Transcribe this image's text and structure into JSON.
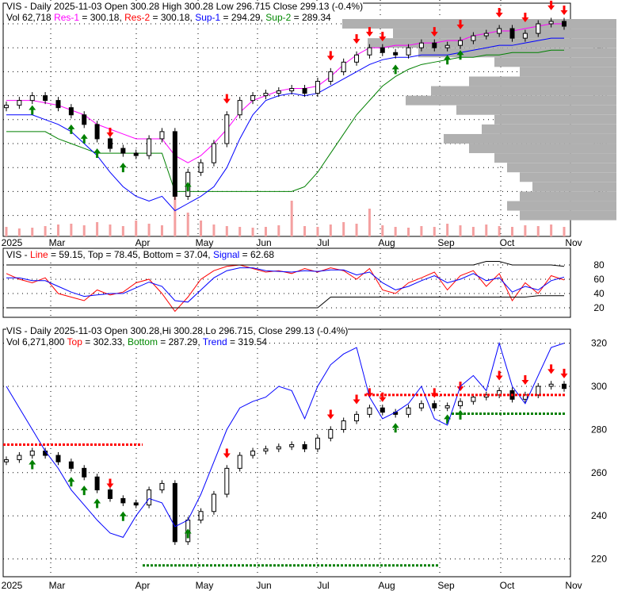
{
  "panel1": {
    "line1": {
      "ticker": "VIS",
      "text": " - Daily 2025-11-03 Open 300.28  High 300.28  Low 296.715  Close 299.13 (-0.4%)"
    },
    "line2": {
      "vol": "Vol 62,718 ",
      "res1": "Res-1",
      "res1v": " = 300.18, ",
      "res2": "Res-2",
      "res2v": " = 300.18, ",
      "sup1": "Sup-1",
      "sup1v": " = 294.29, ",
      "sup2": "Sup-2",
      "sup2v": " = 289.34"
    }
  },
  "panel2": {
    "ticker": "VIS - ",
    "line": "Line",
    "linev": " = 59.15, Top = 78.45, Bottom = 37.04, ",
    "signal": "Signal",
    "signalv": " = 62.68"
  },
  "panel3": {
    "line1": "VIS - Daily 2025-11-03 Open 300.28,Hi 300.28,Lo 296.715, Close 299.13 (-0.4%)",
    "line2": {
      "vol": "Vol 6,271,800 ",
      "top": "Top",
      "topv": " = 302.33, ",
      "bottom": "Bottom",
      "bottomv": " = 287.29, ",
      "trend": "Trend",
      "trendv": " = 319.54"
    }
  },
  "colors": {
    "up": "#000000",
    "down": "#000000",
    "res1": "#ff00ff",
    "res2": "#ff0000",
    "sup1": "#0000ff",
    "sup2": "#008000",
    "arrow_down": "#ff0000",
    "arrow_up": "#008000",
    "volume": "#f4a0a0",
    "profile": "#b0b0b0"
  },
  "chart_data": [
    {
      "type": "candlestick",
      "title": "VIS - Daily",
      "x_labels": [
        "2025",
        "Mar",
        "Apr",
        "May",
        "Jun",
        "Jul",
        "Aug",
        "Sep",
        "Oct",
        "Nov"
      ],
      "y_ticks": [
        300,
        290,
        280,
        270,
        260,
        250,
        240,
        230,
        220
      ],
      "close": [
        266,
        268,
        270,
        268,
        265,
        262,
        258,
        252,
        248,
        246,
        245,
        252,
        255,
        228,
        238,
        242,
        250,
        262,
        268,
        270,
        271,
        272,
        273,
        271,
        276,
        280,
        284,
        287,
        290,
        288,
        287,
        290,
        292,
        290,
        291,
        293,
        295,
        296,
        298,
        294,
        296,
        300,
        301,
        299
      ],
      "sup1": [
        262,
        262,
        262,
        260,
        258,
        255,
        250,
        245,
        238,
        232,
        228,
        226,
        228,
        222,
        225,
        228,
        232,
        240,
        252,
        262,
        268,
        270,
        271,
        270,
        271,
        274,
        277,
        280,
        283,
        285,
        286,
        286,
        287,
        287,
        287,
        288,
        289,
        290,
        291,
        291,
        292,
        293,
        294,
        294
      ],
      "sup2": [
        255,
        255,
        255,
        255,
        252,
        250,
        248,
        246,
        246,
        246,
        246,
        246,
        246,
        230,
        230,
        230,
        230,
        230,
        230,
        230,
        230,
        230,
        230,
        232,
        238,
        246,
        254,
        262,
        268,
        274,
        278,
        281,
        283,
        284,
        285,
        286,
        286,
        287,
        287,
        288,
        288,
        288,
        289,
        289
      ],
      "res1": [
        268,
        268,
        268,
        267,
        266,
        264,
        262,
        258,
        256,
        254,
        252,
        252,
        252,
        245,
        242,
        245,
        250,
        256,
        263,
        268,
        270,
        272,
        273,
        273,
        274,
        278,
        283,
        287,
        290,
        290,
        291,
        291,
        292,
        292,
        293,
        293,
        295,
        296,
        297,
        297,
        298,
        299,
        300,
        300
      ],
      "volume": [
        1.2,
        1,
        1.1,
        1.3,
        1.5,
        1.6,
        1.4,
        1.8,
        1.5,
        1.3,
        2,
        1.6,
        1.4,
        6,
        3,
        2,
        1.5,
        1.3,
        1.2,
        1.1,
        1.2,
        1.4,
        4.5,
        1.3,
        1.2,
        1.5,
        1.8,
        1.6,
        3.5,
        1.4,
        1.2,
        1.1,
        1.3,
        1.2,
        1.6,
        1.4,
        1.2,
        1.5,
        1.3,
        1.2,
        1.4,
        1.3,
        1.5,
        1.2
      ],
      "profile": [
        [
          300,
          90
        ],
        [
          296,
          70
        ],
        [
          292,
          80
        ],
        [
          288,
          60
        ],
        [
          284,
          30
        ],
        [
          280,
          20
        ],
        [
          276,
          40
        ],
        [
          272,
          55
        ],
        [
          268,
          65
        ],
        [
          264,
          45
        ],
        [
          260,
          30
        ],
        [
          256,
          35
        ],
        [
          252,
          50
        ],
        [
          248,
          40
        ],
        [
          244,
          30
        ],
        [
          240,
          25
        ],
        [
          236,
          20
        ],
        [
          232,
          15
        ],
        [
          228,
          20
        ],
        [
          224,
          25
        ],
        [
          220,
          20
        ]
      ],
      "down_arrows": [
        8,
        17,
        25,
        27,
        28,
        29,
        33,
        35,
        38,
        40,
        42,
        43
      ],
      "up_arrows": [
        2,
        5,
        6,
        7,
        9,
        14,
        30,
        34,
        35
      ]
    },
    {
      "type": "line",
      "title": "Oscillator",
      "y_ticks": [
        80,
        60,
        40,
        20
      ],
      "series": [
        {
          "name": "Line",
          "values": [
            68,
            60,
            55,
            62,
            40,
            35,
            30,
            45,
            38,
            42,
            55,
            60,
            40,
            15,
            35,
            60,
            72,
            78,
            80,
            75,
            70,
            72,
            68,
            75,
            70,
            76,
            72,
            60,
            75,
            45,
            40,
            55,
            62,
            70,
            45,
            65,
            72,
            50,
            68,
            30,
            55,
            40,
            65,
            59
          ]
        },
        {
          "name": "Signal",
          "values": [
            62,
            62,
            58,
            58,
            50,
            42,
            36,
            38,
            40,
            40,
            48,
            56,
            50,
            30,
            28,
            45,
            62,
            72,
            76,
            76,
            72,
            71,
            70,
            72,
            71,
            73,
            73,
            66,
            70,
            55,
            45,
            50,
            58,
            65,
            55,
            60,
            68,
            58,
            62,
            42,
            50,
            45,
            58,
            63
          ]
        },
        {
          "name": "Top",
          "values": [
            80,
            80,
            80,
            80,
            80,
            80,
            80,
            80,
            80,
            80,
            80,
            80,
            80,
            80,
            80,
            80,
            80,
            80,
            80,
            80,
            80,
            80,
            80,
            80,
            80,
            80,
            80,
            80,
            80,
            80,
            80,
            80,
            80,
            80,
            80,
            80,
            80,
            85,
            85,
            80,
            80,
            80,
            80,
            78
          ]
        },
        {
          "name": "Bottom",
          "values": [
            20,
            20,
            20,
            20,
            20,
            20,
            20,
            20,
            20,
            20,
            20,
            20,
            20,
            20,
            20,
            20,
            20,
            20,
            20,
            20,
            20,
            20,
            20,
            20,
            20,
            35,
            35,
            35,
            35,
            35,
            35,
            35,
            35,
            35,
            35,
            35,
            35,
            35,
            35,
            35,
            35,
            37,
            37,
            37
          ]
        }
      ]
    },
    {
      "type": "candlestick",
      "title": "VIS - Daily",
      "x_labels": [
        "2025",
        "Mar",
        "Apr",
        "May",
        "Jun",
        "Jul",
        "Aug",
        "Sep",
        "Oct",
        "Nov"
      ],
      "y_ticks": [
        320,
        300,
        280,
        260,
        240,
        220
      ],
      "trend": [
        300,
        290,
        280,
        270,
        262,
        252,
        245,
        238,
        232,
        230,
        240,
        248,
        246,
        235,
        238,
        250,
        265,
        280,
        290,
        293,
        295,
        300,
        298,
        285,
        300,
        310,
        315,
        318,
        295,
        285,
        288,
        292,
        300,
        285,
        282,
        300,
        305,
        298,
        320,
        300,
        292,
        305,
        318,
        320
      ]
    }
  ]
}
